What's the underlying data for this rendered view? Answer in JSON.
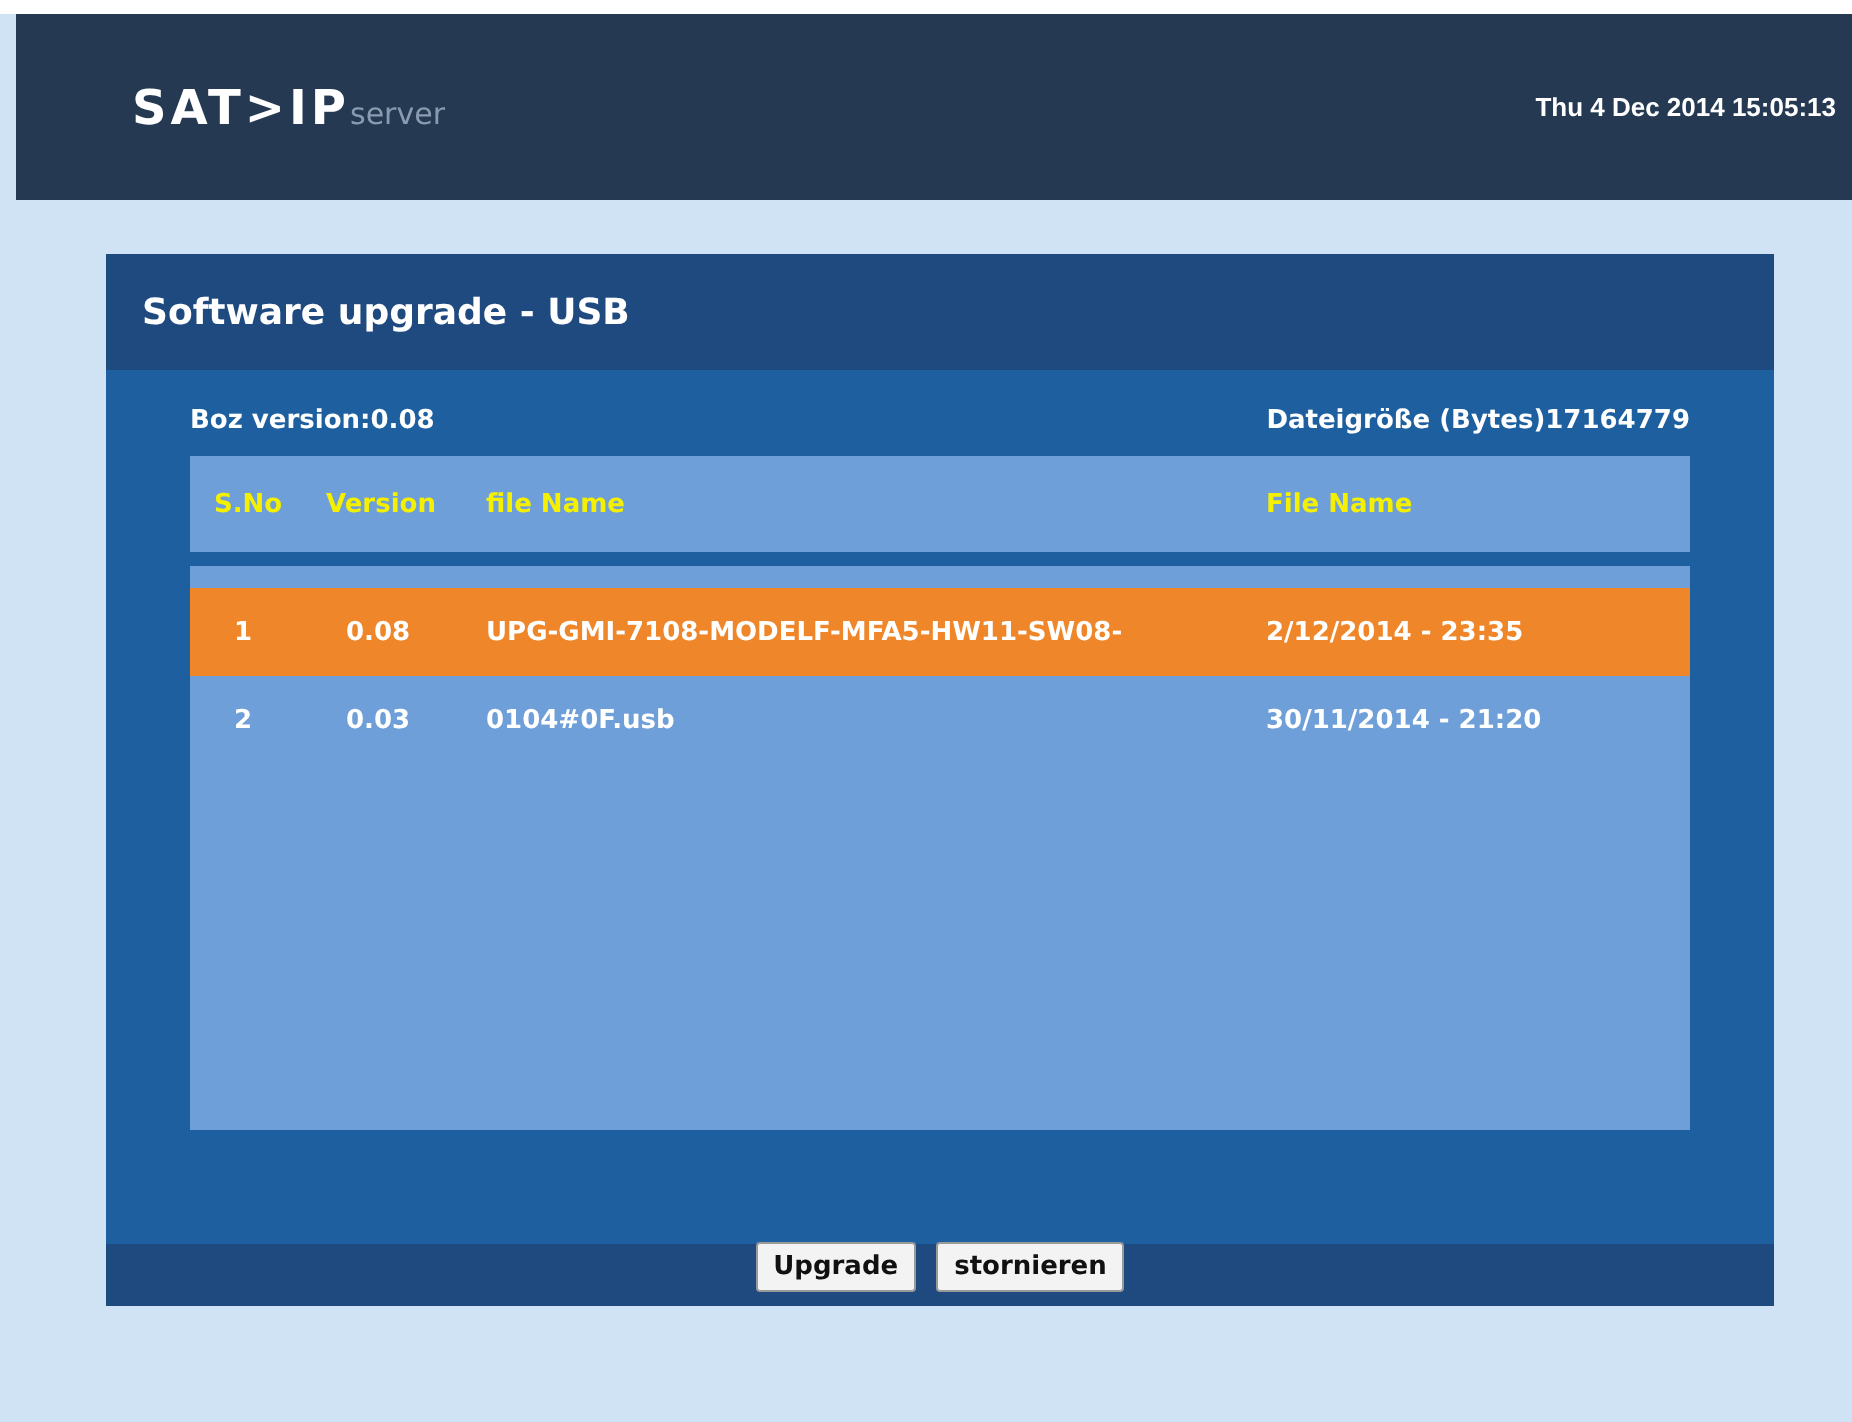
{
  "header": {
    "logo": "SAT>IP",
    "logo_sub": "server",
    "datetime": "Thu 4 Dec 2014 15:05:13"
  },
  "panel": {
    "title": "Software upgrade - USB",
    "box_version": "Boz version:0.08",
    "file_size": "Dateigröße (Bytes)17164779"
  },
  "table": {
    "columns": [
      "S.No",
      "Version",
      "file Name",
      "File Name"
    ],
    "rows": [
      {
        "cells": [
          "1",
          "0.08",
          "UPG-GMI-7108-MODELF-MFA5-HW11-SW08-",
          "2/12/2014 - 23:35"
        ],
        "selected": true
      },
      {
        "cells": [
          "2",
          "0.03",
          "0104#0F.usb",
          "30/11/2014 - 21:20"
        ],
        "selected": false
      }
    ]
  },
  "buttons": [
    "Upgrade",
    "stornieren"
  ]
}
